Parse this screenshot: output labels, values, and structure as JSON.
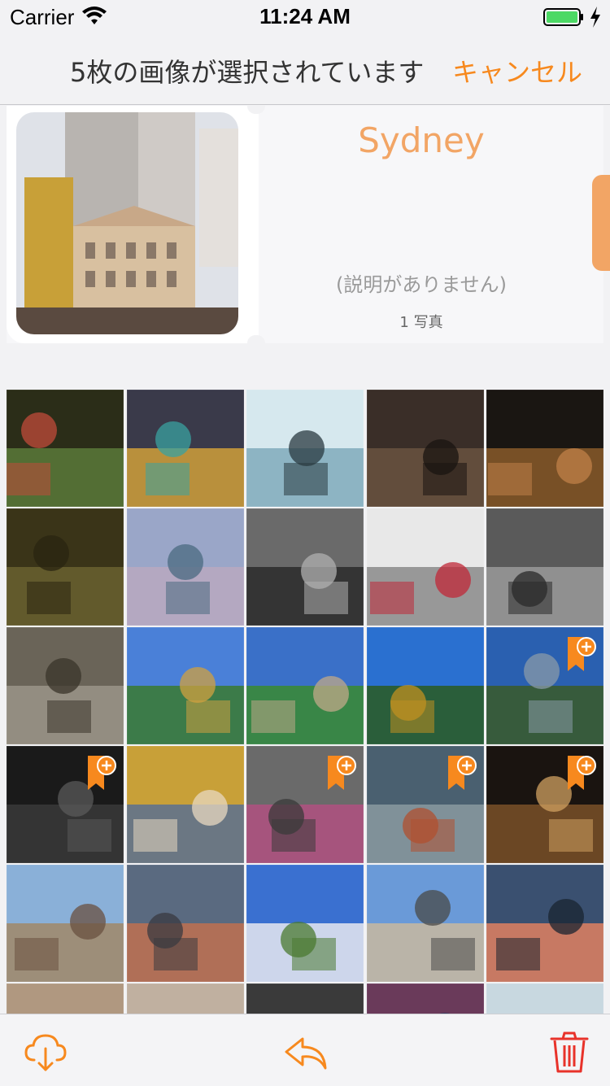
{
  "status": {
    "carrier": "Carrier",
    "time": "11:24 AM"
  },
  "nav": {
    "title": "5枚の画像が選択されています",
    "cancel": "キャンセル"
  },
  "album": {
    "title": "Sydney",
    "description": "(説明がありません)",
    "count": "1 写真"
  },
  "colors": {
    "accent": "#f7891e",
    "album_title": "#f2a565",
    "delete": "#e8322a"
  },
  "grid": [
    {
      "name": "graffiti-wall",
      "colors": [
        "#2b2d18",
        "#5a7a3a",
        "#c14b3a"
      ],
      "selected": false
    },
    {
      "name": "street-mural",
      "colors": [
        "#3a3a4a",
        "#d0a03a",
        "#3aa2a0"
      ],
      "selected": false
    },
    {
      "name": "db-station",
      "colors": [
        "#d6e8ee",
        "#80aabb",
        "#2a3a40"
      ],
      "selected": false
    },
    {
      "name": "railing-finials",
      "colors": [
        "#3a2e28",
        "#6a5240",
        "#1a1410"
      ],
      "selected": false
    },
    {
      "name": "pottery-shelf",
      "colors": [
        "#1a1612",
        "#8a5a2a",
        "#c08048"
      ],
      "selected": false
    },
    {
      "name": "abandoned-room",
      "colors": [
        "#3a3418",
        "#6a6230",
        "#2a2410"
      ],
      "selected": false
    },
    {
      "name": "dam-reflection",
      "colors": [
        "#9aa6c8",
        "#b8a8c0",
        "#4a6a80"
      ],
      "selected": false
    },
    {
      "name": "bw-window-field",
      "colors": [
        "#6a6a6a",
        "#2a2a2a",
        "#b0b0b0"
      ],
      "selected": false
    },
    {
      "name": "portrait-red-door",
      "colors": [
        "#e8e8e8",
        "#8a8a8a",
        "#c02838"
      ],
      "selected": false
    },
    {
      "name": "bw-theatre",
      "colors": [
        "#5a5a5a",
        "#9a9a9a",
        "#2a2a2a"
      ],
      "selected": false
    },
    {
      "name": "castle-gate",
      "colors": [
        "#6a6458",
        "#9a9488",
        "#3a342a"
      ],
      "selected": false
    },
    {
      "name": "palace-fountains",
      "colors": [
        "#4a80d8",
        "#3a7a30",
        "#d0a040"
      ],
      "selected": false
    },
    {
      "name": "palace-garden",
      "colors": [
        "#3a70c8",
        "#3a8a30",
        "#c0a888"
      ],
      "selected": false
    },
    {
      "name": "golden-fountain",
      "colors": [
        "#2a70d0",
        "#2a5a20",
        "#c09020"
      ],
      "selected": false
    },
    {
      "name": "fountain-pond",
      "colors": [
        "#2a60b0",
        "#3a5a28",
        "#8a9aa8"
      ],
      "selected": true
    },
    {
      "name": "walk-of-fame-star",
      "colors": [
        "#1a1a1a",
        "#3a3a3a",
        "#5a5a5a"
      ],
      "selected": true
    },
    {
      "name": "timber-houses",
      "colors": [
        "#c8a038",
        "#5a7090",
        "#e8d8c0"
      ],
      "selected": false
    },
    {
      "name": "bird-mural",
      "colors": [
        "#6a6a6a",
        "#b05080",
        "#3a3a3a"
      ],
      "selected": true
    },
    {
      "name": "city-panorama",
      "colors": [
        "#4a6070",
        "#8a9aa0",
        "#b05030"
      ],
      "selected": true
    },
    {
      "name": "night-plaza",
      "colors": [
        "#1a1410",
        "#7a5028",
        "#d0a060"
      ],
      "selected": true
    },
    {
      "name": "stone-rooftops",
      "colors": [
        "#8ab0d8",
        "#a08868",
        "#6a5040"
      ],
      "selected": false
    },
    {
      "name": "bridge-reflection",
      "colors": [
        "#5a6a80",
        "#c07050",
        "#3a3a40"
      ],
      "selected": false
    },
    {
      "name": "orthodox-church",
      "colors": [
        "#3a70d0",
        "#e8e8f0",
        "#4a7a30"
      ],
      "selected": false
    },
    {
      "name": "corner-building",
      "colors": [
        "#6a9ad8",
        "#c8b8a0",
        "#4a4a48"
      ],
      "selected": false
    },
    {
      "name": "harbour-dusk",
      "colors": [
        "#3a5070",
        "#e08060",
        "#1a2430"
      ],
      "selected": false
    },
    {
      "name": "interior-arch",
      "colors": [
        "#b09880",
        "#e8d8c8",
        "#5a4838"
      ],
      "selected": false
    },
    {
      "name": "interior-dome",
      "colors": [
        "#c0b0a0",
        "#e0d0c0",
        "#6a5a48"
      ],
      "selected": false
    },
    {
      "name": "blurred-street",
      "colors": [
        "#3a3a3a",
        "#8a8a8a",
        "#1a1a1a"
      ],
      "selected": false
    },
    {
      "name": "market-stall",
      "colors": [
        "#6a3a5a",
        "#d0a030",
        "#2a3a60"
      ],
      "selected": false
    },
    {
      "name": "glass-building",
      "colors": [
        "#c8d8e0",
        "#e8f0f4",
        "#8aa0b0"
      ],
      "selected": false
    }
  ],
  "toolbar": {
    "download_icon": "cloud-download-icon",
    "share_icon": "reply-icon",
    "delete_icon": "trash-icon"
  }
}
